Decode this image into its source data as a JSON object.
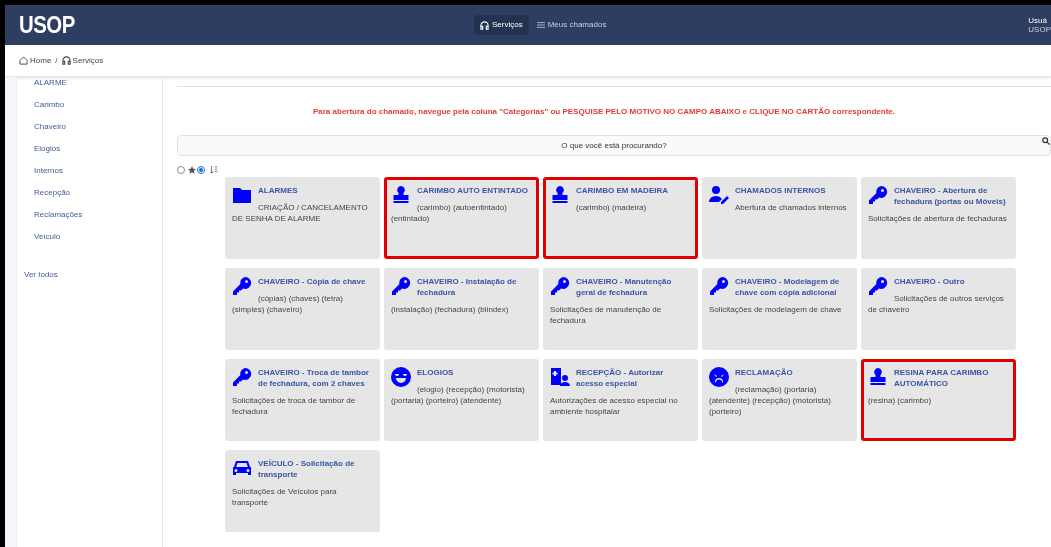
{
  "header": {
    "logo": "USOP",
    "nav": [
      {
        "label": "Serviços",
        "kind": "headset",
        "selected": true
      },
      {
        "label": "Meus chamados",
        "kind": "list",
        "selected": false
      }
    ],
    "user": {
      "name": "Usuá",
      "org": "USOP"
    }
  },
  "breadcrumb": [
    {
      "label": "Home",
      "kind": "home"
    },
    {
      "label": "Serviços",
      "kind": "headset"
    }
  ],
  "breadcrumb_separator": "/",
  "sidebar": {
    "items": [
      "ALARME",
      "Carimbo",
      "Chaveiro",
      "Elogios",
      "Internos",
      "Recepção",
      "Reclamações",
      "Veículo"
    ],
    "see_all": "Ver todos"
  },
  "notice": "Para abertura do chamado, navegue pela coluna \"Categorias\" ou PESQUISE PELO MOTIVO NO CAMPO ABAIXO e CLIQUE NO CARTÃO correspondente.",
  "search": {
    "placeholder": "O que você está procurando?"
  },
  "filters": [
    {
      "kind": "plain",
      "selected": false
    },
    {
      "kind": "star",
      "selected": true
    }
  ],
  "cards": [
    {
      "kind": "folder",
      "title": "ALARMES",
      "description": "CRIAÇÃO / CANCELAMENTO DE SENHA DE ALARME",
      "highlighted": false
    },
    {
      "kind": "stamp",
      "title": "CARIMBO AUTO ENTINTADO",
      "description": "(carimbo) (autoentintado) (entintado)",
      "highlighted": true
    },
    {
      "kind": "stamp",
      "title": "CARIMBO EM MADEIRA",
      "description": "(carimbo) (madeira)",
      "highlighted": true
    },
    {
      "kind": "user-pen",
      "title": "CHAMADOS INTERNOS",
      "description": "Abertura de chamados internos",
      "highlighted": false
    },
    {
      "kind": "key",
      "title": "CHAVEIRO - Abertura de fechadura (portas ou Móveis)",
      "description": "Solicitações de abertura de fechaduras",
      "highlighted": false
    },
    {
      "kind": "key",
      "title": "CHAVEIRO - Cópia de chave",
      "description": "(cópias) (chaves) (tetra) (simples) (chaveiro)",
      "highlighted": false
    },
    {
      "kind": "key",
      "title": "CHAVEIRO - Instalação de fechadura",
      "description": "(instalação) (fechadura) (blindex)",
      "highlighted": false
    },
    {
      "kind": "key",
      "title": "CHAVEIRO - Manutenção geral de fechadura",
      "description": "Solicitações de manutenção de fechadura",
      "highlighted": false
    },
    {
      "kind": "key",
      "title": "CHAVEIRO - Modelagem de chave com cópia adicional",
      "description": "Solicitações de modelagem de chave",
      "highlighted": false
    },
    {
      "kind": "key",
      "title": "CHAVEIRO - Outro",
      "description": "Solicitações de outros serviços de chaveiro",
      "highlighted": false
    },
    {
      "kind": "key",
      "title": "CHAVEIRO - Troca de tambor de fechadura, com 2 chaves",
      "description": "Solicitações de troca de tambor de fechadura",
      "highlighted": false
    },
    {
      "kind": "smile",
      "title": "ELOGIOS",
      "description": "(elogio) (recepção) (motorista) (portaria) (porteiro) (atendente)",
      "highlighted": false
    },
    {
      "kind": "badge",
      "title": "RECEPÇÃO - Autorizar acesso especial",
      "description": "Autorizações de acesso especial no ambiente hospitalar",
      "highlighted": false
    },
    {
      "kind": "angry",
      "title": "RECLAMAÇÃO",
      "description": "(reclamação) (portaria) (atendente) (recepção) (motorista) (porteiro)",
      "highlighted": false
    },
    {
      "kind": "stamp",
      "title": "RESINA PARA CARIMBO AUTOMÁTICO",
      "description": "(resina) (carimbo)",
      "highlighted": true
    },
    {
      "kind": "car",
      "title": "VEÍCULO - Solicitação de transporte",
      "description": "Solicitações de Veículos para transporte",
      "highlighted": false
    }
  ]
}
